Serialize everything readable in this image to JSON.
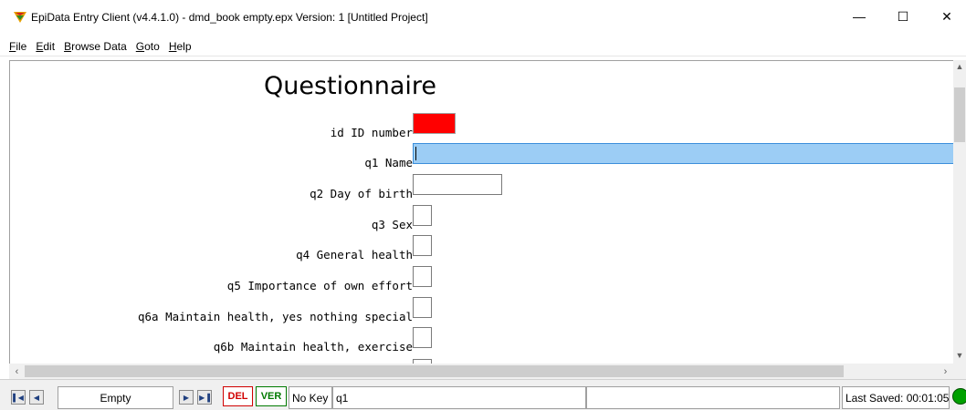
{
  "window": {
    "title": "EpiData Entry Client (v4.4.1.0) - dmd_book empty.epx Version: 1 [Untitled Project]",
    "min_glyph": "—",
    "max_glyph": "☐",
    "close_glyph": "✕"
  },
  "menu": {
    "items": [
      {
        "key": "F",
        "rest": "ile"
      },
      {
        "key": "E",
        "rest": "dit"
      },
      {
        "key": "B",
        "rest": "rowse Data"
      },
      {
        "key": "G",
        "rest": "oto"
      },
      {
        "key": "H",
        "rest": "elp"
      }
    ]
  },
  "form": {
    "title": "Questionnaire",
    "fields": [
      {
        "label": "id ID number"
      },
      {
        "label": "q1 Name"
      },
      {
        "label": "q2 Day of birth"
      },
      {
        "label": "q3 Sex"
      },
      {
        "label": "q4 General health"
      },
      {
        "label": "q5 Importance of own effort"
      },
      {
        "label": "q6a Maintain health, yes nothing special"
      },
      {
        "label": "q6b Maintain health, exercise"
      }
    ]
  },
  "statusbar": {
    "record": "Empty",
    "del_label": "DEL",
    "ver_label": "VER",
    "key_info": "No Key",
    "current_field": "q1",
    "extra": "",
    "last_saved": "Last Saved: 00:01:05"
  },
  "colors": {
    "id_field": "#ff0000",
    "active_field": "#9ccdf5",
    "status_led": "#00a000"
  }
}
